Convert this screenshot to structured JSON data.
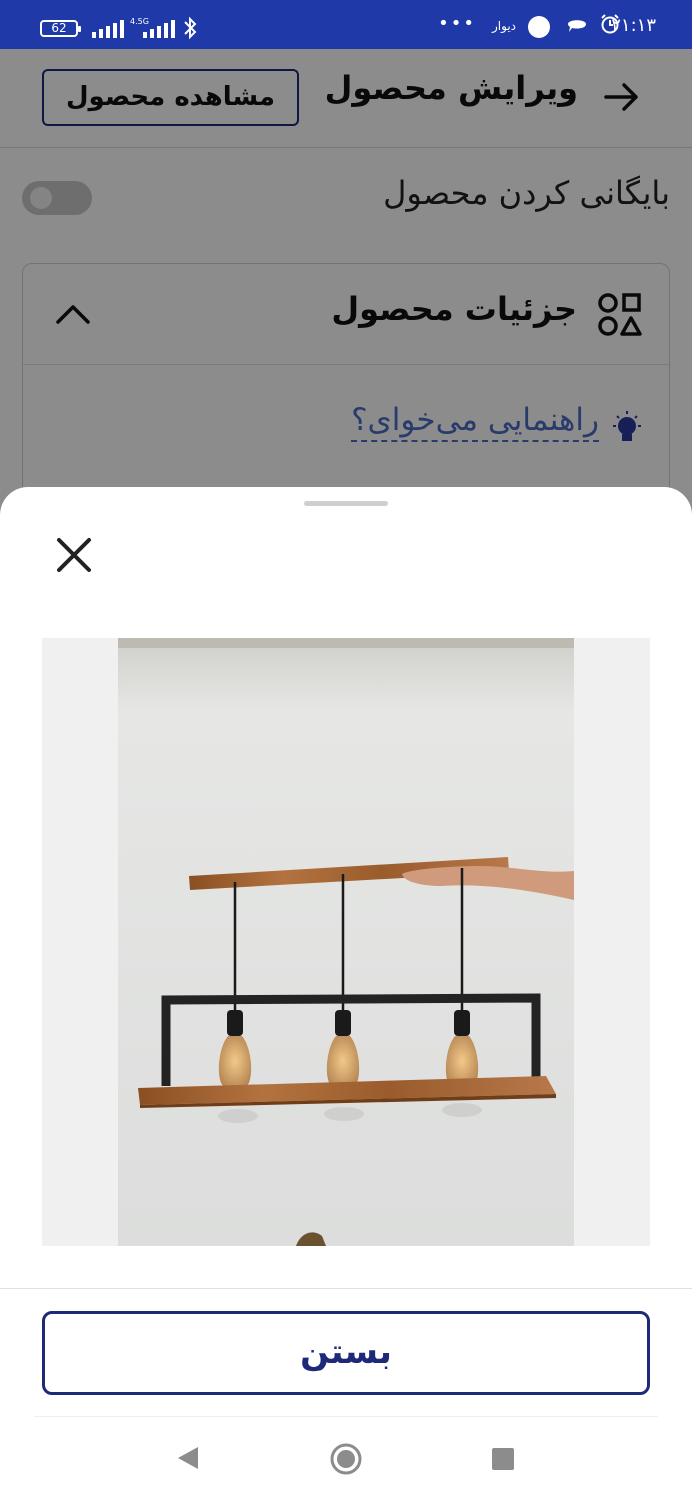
{
  "status_bar": {
    "time": "۲۱:۱۳",
    "app_label": "دیوار",
    "battery": "62",
    "network": "4.5G",
    "dots": "•••",
    "color": "#1f3aa8"
  },
  "header": {
    "title": "ویرایش محصول",
    "view_product": "مشاهده محصول"
  },
  "archive": {
    "label": "بایگانی کردن محصول",
    "enabled": false
  },
  "details_card": {
    "title": "جزئیات محصول",
    "guide_link": "راهنمایی می‌خوای؟"
  },
  "sheet": {
    "close_button": "بستن"
  },
  "icons": [
    "arrow-right-icon",
    "shapes-icon",
    "chevron-up-icon",
    "lightbulb-icon",
    "close-icon",
    "nav-back-icon",
    "nav-home-icon",
    "nav-recent-icon"
  ],
  "colors": {
    "accent": "#1e2a78",
    "link": "#4a6cc4"
  }
}
